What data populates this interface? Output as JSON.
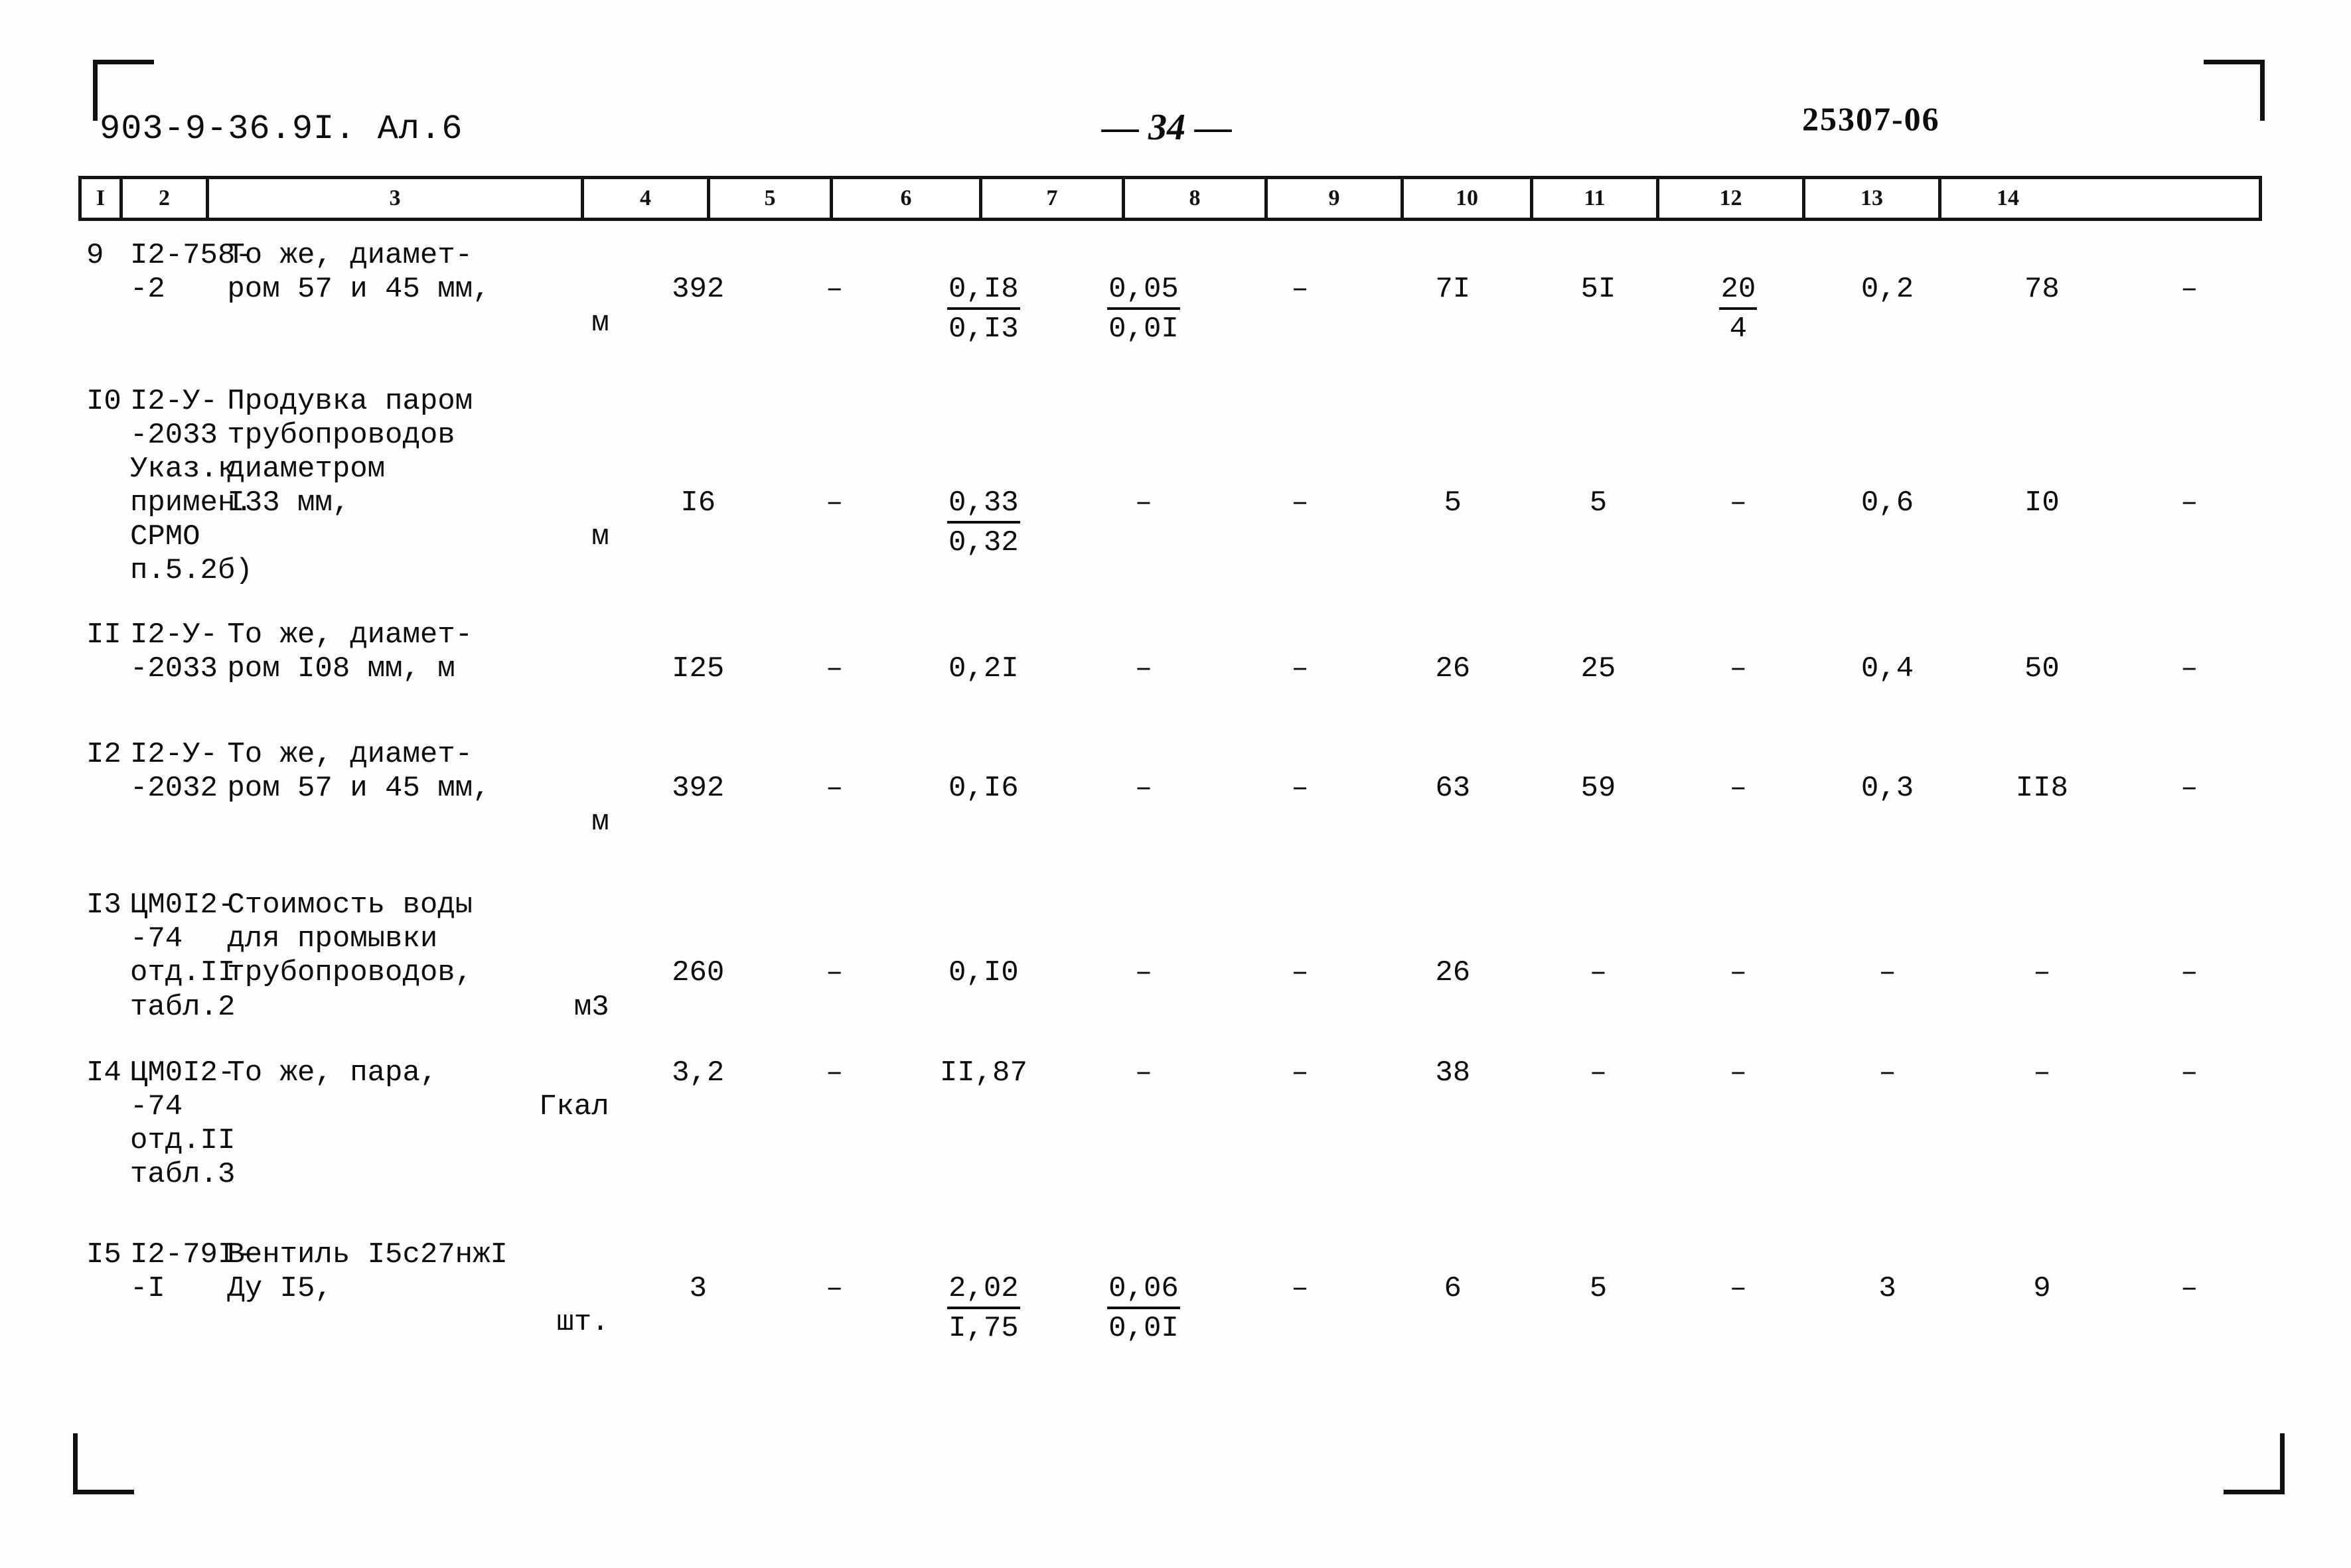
{
  "header": {
    "doc_code": "903-9-36.9I. Ал.6",
    "page_number": "— 34 —",
    "stamp_code": "25307-06"
  },
  "table": {
    "column_numbers": [
      "I",
      "2",
      "3",
      "4",
      "5",
      "6",
      "7",
      "8",
      "9",
      "10",
      "11",
      "12",
      "13",
      "14"
    ],
    "rows": [
      {
        "num": "9",
        "code": "I2-758-\n-2",
        "desc": "То же, диамет-\nром 57 и 45 мм,",
        "unit": "м",
        "c4": "392",
        "c5": "–",
        "c6_top": "0,I8",
        "c6_bot": "0,I3",
        "c7_top": "0,05",
        "c7_bot": "0,0I",
        "c8": "–",
        "c9": "7I",
        "c10": "5I",
        "c11_top": "20",
        "c11_bot": "4",
        "c12": "0,2",
        "c13": "78",
        "c14": "–"
      },
      {
        "num": "I0",
        "code": "I2-У-\n-2033\nУказ.к\nпримен.\nСРМО\nп.5.2б)",
        "desc": "Продувка паром\nтрубопроводов\nдиаметром\nI33 мм,",
        "unit": "м",
        "c4": "I6",
        "c5": "–",
        "c6_top": "0,33",
        "c6_bot": "0,32",
        "c7": "–",
        "c8": "–",
        "c9": "5",
        "c10": "5",
        "c11": "–",
        "c12": "0,6",
        "c13": "I0",
        "c14": "–"
      },
      {
        "num": "II",
        "code": "I2-У-\n-2033",
        "desc": "То же, диамет-\nром I08 мм, м",
        "unit": "",
        "c4": "I25",
        "c5": "–",
        "c6": "0,2I",
        "c7": "–",
        "c8": "–",
        "c9": "26",
        "c10": "25",
        "c11": "–",
        "c12": "0,4",
        "c13": "50",
        "c14": "–"
      },
      {
        "num": "I2",
        "code": "I2-У-\n-2032",
        "desc": "То же, диамет-\nром 57 и 45 мм,",
        "unit": "м",
        "c4": "392",
        "c5": "–",
        "c6": "0,I6",
        "c7": "–",
        "c8": "–",
        "c9": "63",
        "c10": "59",
        "c11": "–",
        "c12": "0,3",
        "c13": "II8",
        "c14": "–"
      },
      {
        "num": "I3",
        "code": "ЦМ0I2-\n-74\nотд.II\nтабл.2",
        "desc": "Стоимость воды\nдля промывки\nтрубопроводов,",
        "unit": "м3",
        "c4": "260",
        "c5": "–",
        "c6": "0,I0",
        "c7": "–",
        "c8": "–",
        "c9": "26",
        "c10": "–",
        "c11": "–",
        "c12": "–",
        "c13": "–",
        "c14": "–"
      },
      {
        "num": "I4",
        "code": "ЦМ0I2-\n-74\nотд.II\nтабл.3",
        "desc": "То же, пара,",
        "unit": "Гкал",
        "c4": "3,2",
        "c5": "–",
        "c6": "II,87",
        "c7": "–",
        "c8": "–",
        "c9": "38",
        "c10": "–",
        "c11": "–",
        "c12": "–",
        "c13": "–",
        "c14": "–"
      },
      {
        "num": "I5",
        "code": "I2-79I-\n-I",
        "desc": "Вентиль I5с27нжI\nДу I5,",
        "unit": "шт.",
        "c4": "3",
        "c5": "–",
        "c6_top": "2,02",
        "c6_bot": "I,75",
        "c7_top": "0,06",
        "c7_bot": "0,0I",
        "c8": "–",
        "c9": "6",
        "c10": "5",
        "c11": "–",
        "c12": "3",
        "c13": "9",
        "c14": "–"
      }
    ]
  }
}
